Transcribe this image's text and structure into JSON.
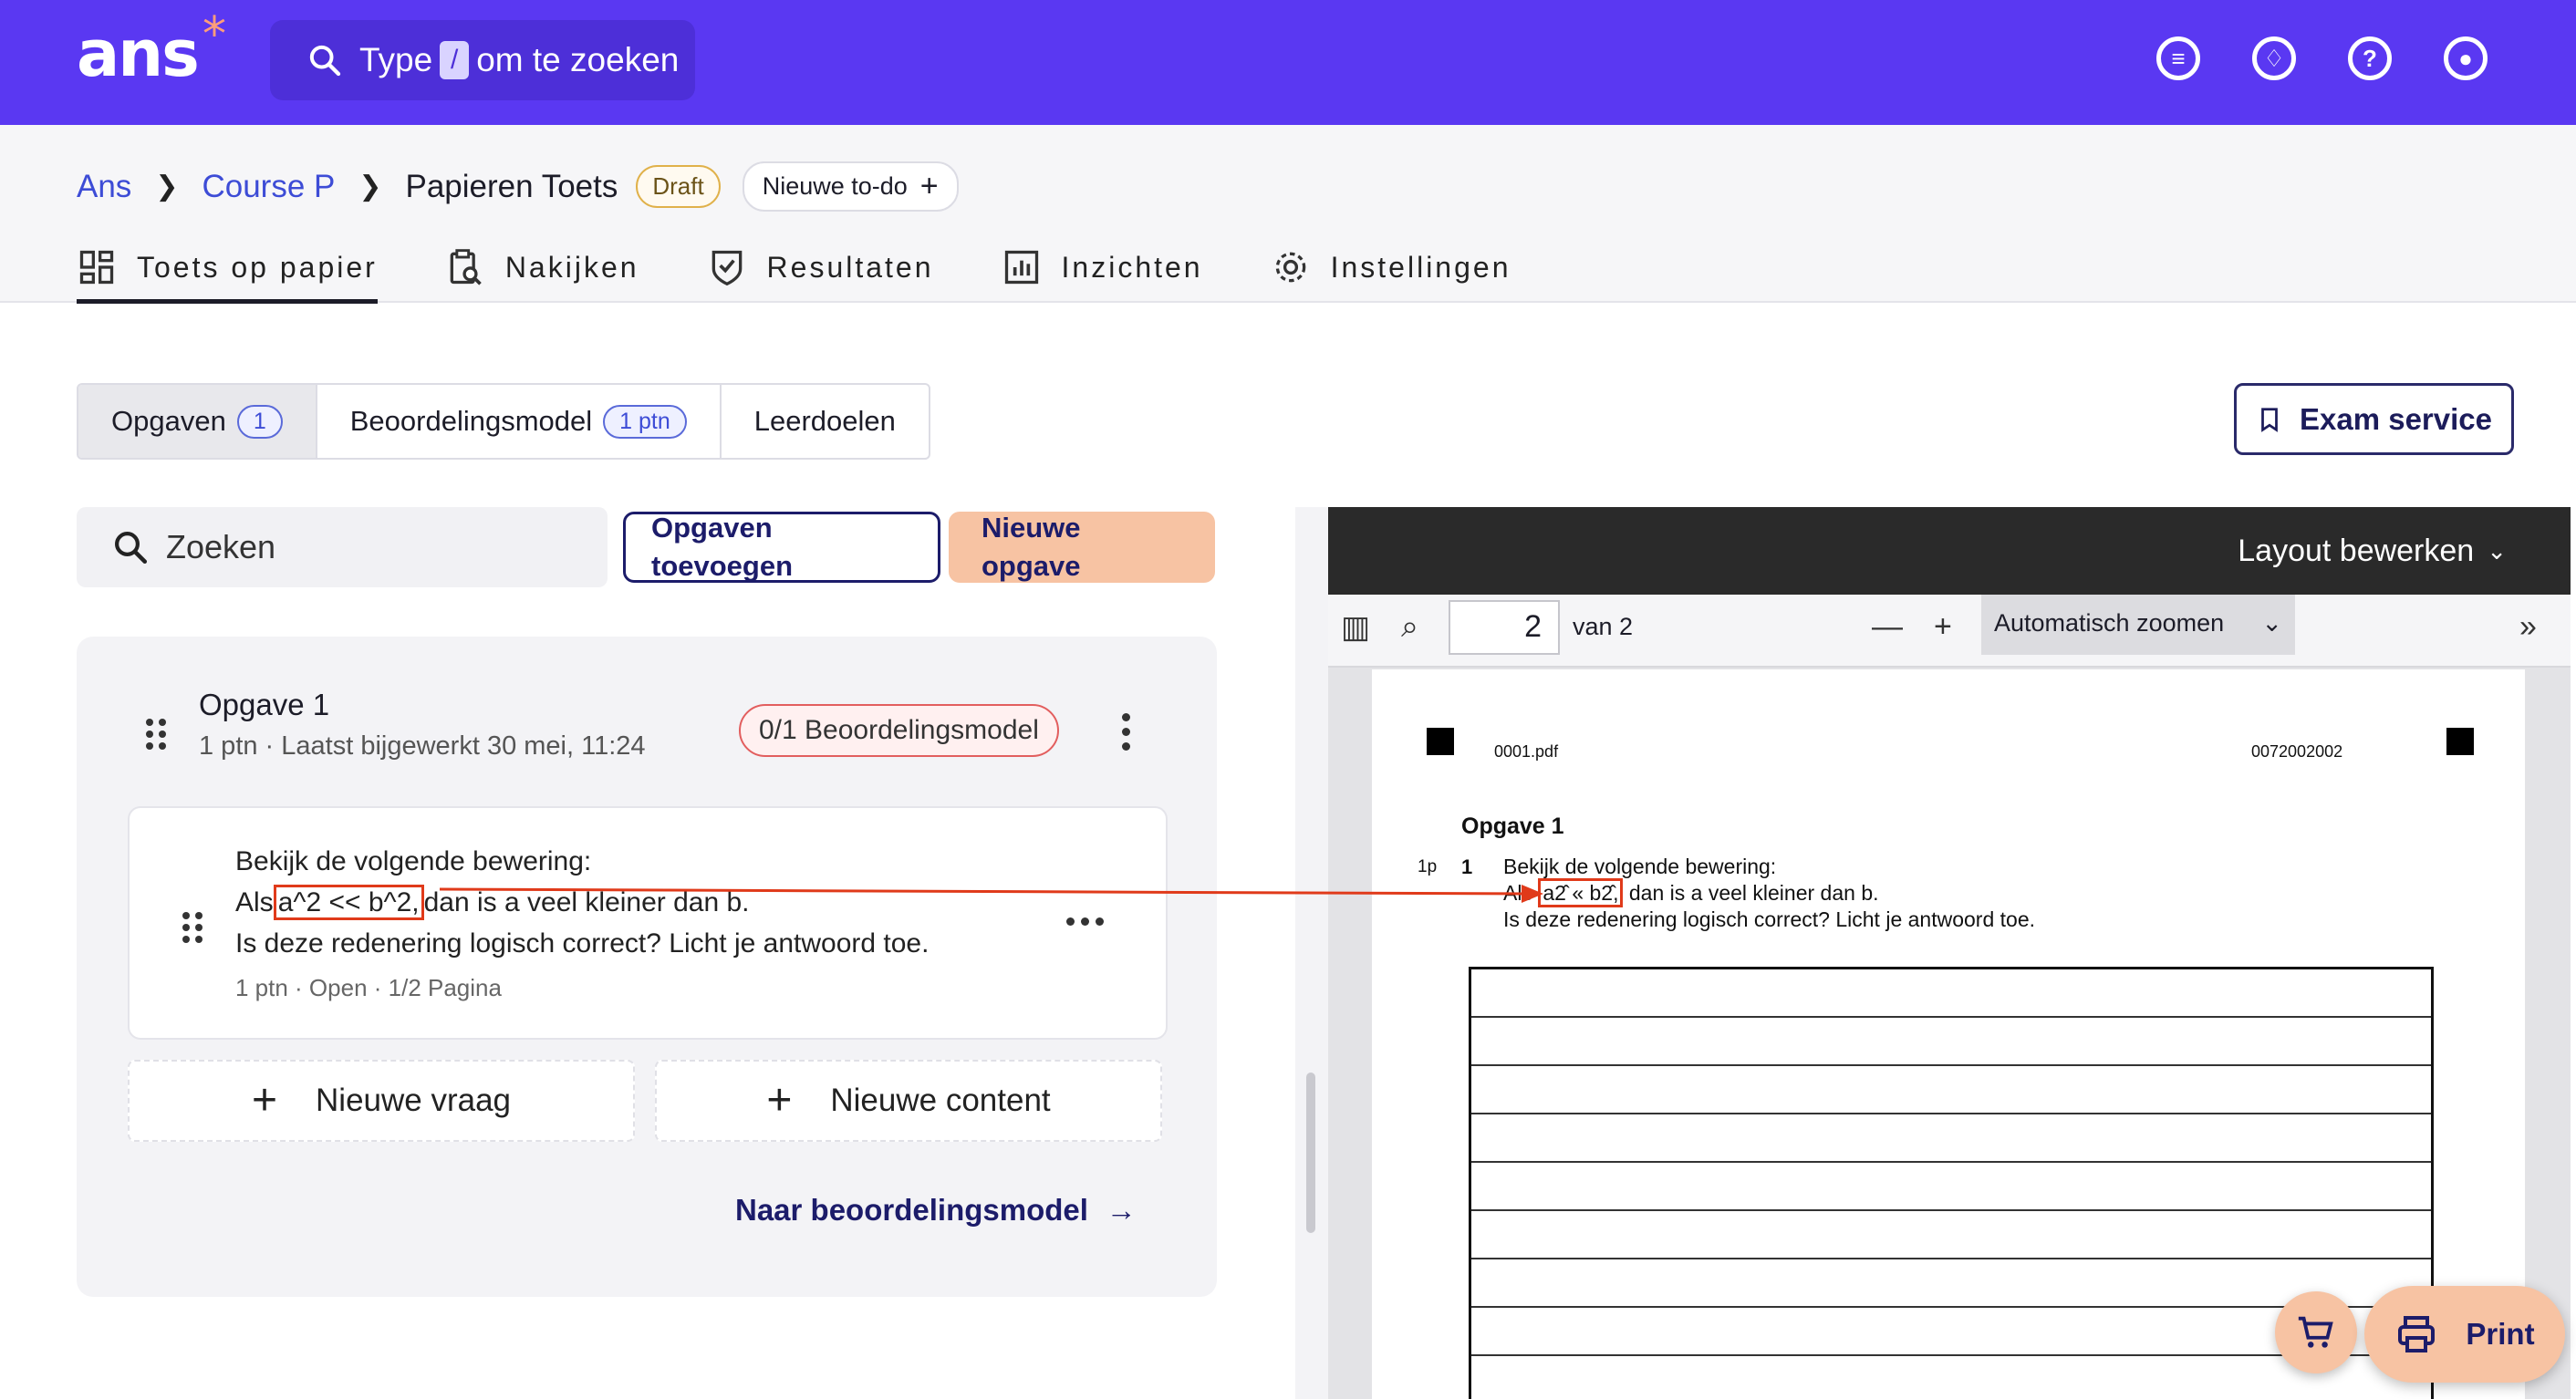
{
  "topbar": {
    "logo": "ans",
    "logo_star": "*",
    "search_prefix": "Type",
    "search_key": "/",
    "search_suffix": "om te zoeken",
    "icons": [
      "messages-icon",
      "notifications-icon",
      "help-icon",
      "account-icon"
    ],
    "accent": "#5a38f2"
  },
  "breadcrumb": {
    "items": [
      "Ans",
      "Course P",
      "Papieren Toets"
    ],
    "status": "Draft",
    "todo": "Nieuwe to-do"
  },
  "tabs": [
    {
      "label": "Toets op papier",
      "icon": "layout-icon",
      "active": true
    },
    {
      "label": "Nakijken",
      "icon": "clipboard-search-icon"
    },
    {
      "label": "Resultaten",
      "icon": "shield-check-icon"
    },
    {
      "label": "Inzichten",
      "icon": "chart-icon"
    },
    {
      "label": "Instellingen",
      "icon": "gear-icon"
    }
  ],
  "subtabs": {
    "opgaven": "Opgaven",
    "opgaven_count": "1",
    "model": "Beoordelingsmodel",
    "model_pill": "1 ptn",
    "goals": "Leerdoelen"
  },
  "exam_service": "Exam service",
  "toolbar": {
    "search_placeholder": "Zoeken",
    "add_existing": "Opgaven toevoegen",
    "new": "Nieuwe opgave"
  },
  "question": {
    "title": "Opgave 1",
    "meta": "1 ptn · Laatst bijgewerkt 30 mei, 11:24",
    "model_badge": "0/1 Beoordelingsmodel",
    "line1": "Bekijk de volgende bewering:",
    "line2_pre": "Als",
    "line2_hl": "a^2 << b^2,",
    "line2_post": "dan is a veel kleiner dan b.",
    "line3": "Is deze redenering logisch correct? Licht je antwoord toe.",
    "sub": "1 ptn · Open · 1/2 Pagina",
    "new_question": "Nieuwe vraag",
    "new_content": "Nieuwe content",
    "to_model": "Naar beoordelingsmodel"
  },
  "viewer": {
    "layout": "Layout bewerken",
    "page": "2",
    "of": "van 2",
    "zoom": "Automatisch zoomen",
    "doc": {
      "file": "0001.pdf",
      "code": "0072002002",
      "heading": "Opgave 1",
      "points": "1p",
      "num": "1",
      "l1": "Bekijk de volgende bewering:",
      "l2_pre": "Als",
      "l2_hl": "a2̂ « b2̂,",
      "l2_post": "dan is a veel kleiner dan b.",
      "l3": "Is deze redenering logisch correct? Licht je antwoord toe."
    }
  },
  "print": "Print",
  "annotation_color": "#e03a1a"
}
